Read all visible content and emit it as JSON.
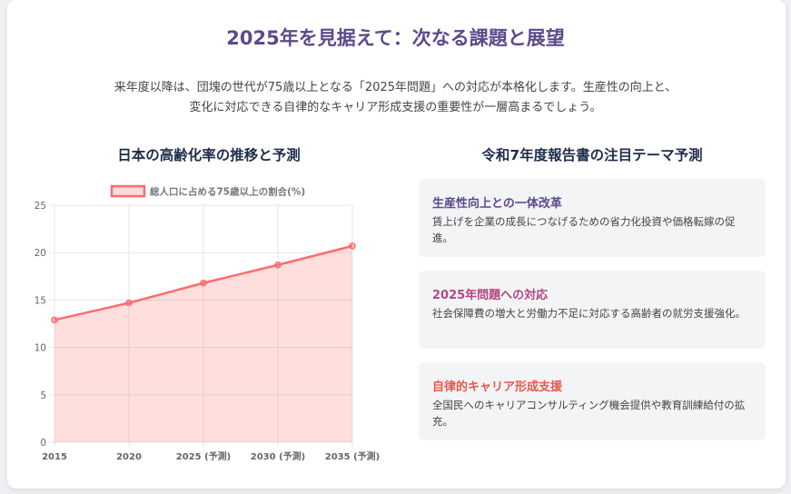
{
  "header": {
    "title": "2025年を見据えて：次なる課題と展望",
    "intro_line1": "来年度以降は、団塊の世代が75歳以上となる「2025年問題」への対応が本格化します。生産性の向上と、",
    "intro_line2": "変化に対応できる自律的なキャリア形成支援の重要性が一層高まるでしょう。"
  },
  "chart_section": {
    "title": "日本の高齢化率の推移と予測"
  },
  "topics_section": {
    "title": "令和7年度報告書の注目テーマ予測",
    "items": [
      {
        "title": "生産性向上との一体改革",
        "color": "#5b4a8b",
        "body": "賃上げを企業の成長につなげるための省力化投資や価格転嫁の促進。"
      },
      {
        "title": "2025年問題への対応",
        "color": "#b5467f",
        "body": "社会保障費の増大と労働力不足に対応する高齢者の就労支援強化。"
      },
      {
        "title": "自律的キャリア形成支援",
        "color": "#e8574a",
        "body": "全国民へのキャリアコンサルティング機会提供や教育訓練給付の拡充。"
      }
    ]
  },
  "chart_data": {
    "type": "area",
    "categories": [
      "2015",
      "2020",
      "2025 (予測)",
      "2030 (予測)",
      "2035 (予測)"
    ],
    "series": [
      {
        "name": "総人口に占める75歳以上の割合(%)",
        "values": [
          12.9,
          14.7,
          16.8,
          18.7,
          20.7
        ],
        "color": "#ff6b6b"
      }
    ],
    "ylim": [
      0,
      25
    ],
    "yticks": [
      0,
      5,
      10,
      15,
      20,
      25
    ],
    "grid": true,
    "legend": "top"
  }
}
